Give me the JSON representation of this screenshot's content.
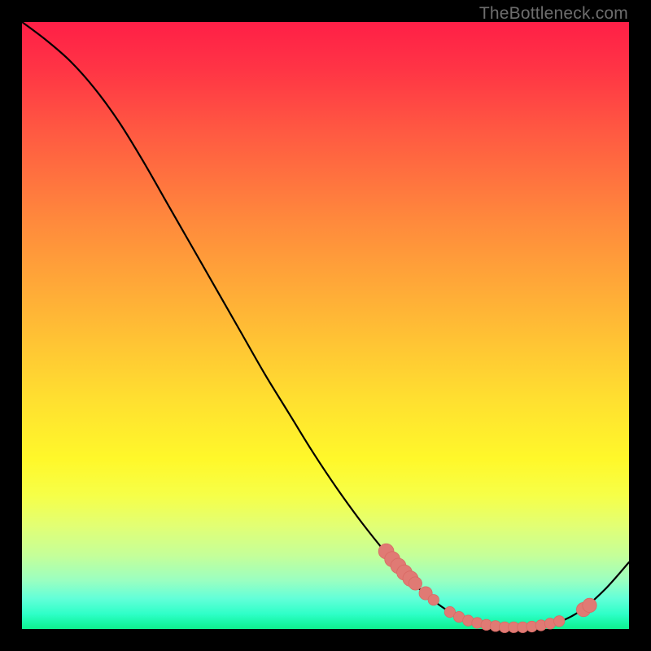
{
  "watermark": "TheBottleneck.com",
  "colors": {
    "curve": "#000000",
    "dot": "#e07a74",
    "dot_stroke": "#d86a64",
    "background": "#000000"
  },
  "chart_data": {
    "type": "line",
    "title": "",
    "xlabel": "",
    "ylabel": "",
    "xlim": [
      0,
      100
    ],
    "ylim": [
      0,
      100
    ],
    "grid": false,
    "legend": false,
    "series": [
      {
        "name": "curve",
        "x": [
          0,
          4,
          8,
          12,
          16,
          20,
          24,
          28,
          32,
          36,
          40,
          44,
          48,
          52,
          56,
          60,
          64,
          68,
          72,
          76,
          80,
          84,
          88,
          92,
          96,
          100
        ],
        "values": [
          100,
          97,
          93.5,
          89,
          83.5,
          77,
          70,
          63,
          56,
          49,
          42,
          35.5,
          29,
          23,
          17.5,
          12.5,
          8,
          4.5,
          2,
          0.8,
          0.3,
          0.3,
          1,
          3,
          6.5,
          11
        ]
      }
    ],
    "markers": [
      {
        "x": 60.0,
        "y": 12.8,
        "r": 1.4
      },
      {
        "x": 61.0,
        "y": 11.5,
        "r": 1.4
      },
      {
        "x": 62.0,
        "y": 10.4,
        "r": 1.4
      },
      {
        "x": 63.0,
        "y": 9.3,
        "r": 1.4
      },
      {
        "x": 64.0,
        "y": 8.3,
        "r": 1.4
      },
      {
        "x": 64.8,
        "y": 7.5,
        "r": 1.2
      },
      {
        "x": 66.5,
        "y": 5.9,
        "r": 1.2
      },
      {
        "x": 67.8,
        "y": 4.8,
        "r": 1.0
      },
      {
        "x": 70.5,
        "y": 2.8,
        "r": 1.0
      },
      {
        "x": 72.0,
        "y": 2.0,
        "r": 1.0
      },
      {
        "x": 73.5,
        "y": 1.4,
        "r": 1.0
      },
      {
        "x": 75.0,
        "y": 1.0,
        "r": 1.0
      },
      {
        "x": 76.5,
        "y": 0.7,
        "r": 1.0
      },
      {
        "x": 78.0,
        "y": 0.5,
        "r": 1.0
      },
      {
        "x": 79.5,
        "y": 0.3,
        "r": 1.0
      },
      {
        "x": 81.0,
        "y": 0.3,
        "r": 1.0
      },
      {
        "x": 82.5,
        "y": 0.3,
        "r": 1.0
      },
      {
        "x": 84.0,
        "y": 0.4,
        "r": 1.0
      },
      {
        "x": 85.5,
        "y": 0.6,
        "r": 1.0
      },
      {
        "x": 87.0,
        "y": 0.9,
        "r": 1.0
      },
      {
        "x": 88.5,
        "y": 1.3,
        "r": 1.0
      },
      {
        "x": 92.5,
        "y": 3.2,
        "r": 1.3
      },
      {
        "x": 93.5,
        "y": 3.9,
        "r": 1.3
      }
    ]
  }
}
